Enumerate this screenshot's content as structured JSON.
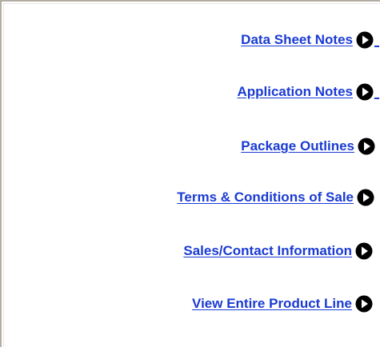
{
  "links": [
    {
      "label": "Data Sheet Notes",
      "icon": "arrow-right-circle-icon"
    },
    {
      "label": "Application Notes",
      "icon": "arrow-right-circle-icon"
    },
    {
      "label": "Package Outlines",
      "icon": "arrow-right-circle-icon"
    },
    {
      "label": "Terms & Conditions of Sale",
      "icon": "arrow-right-circle-icon"
    },
    {
      "label": "Sales/Contact Information",
      "icon": "arrow-right-circle-icon"
    },
    {
      "label": "View Entire Product Line",
      "icon": "arrow-right-circle-icon"
    }
  ],
  "colors": {
    "link": "#1a3bd3",
    "visited_stub": "#7b2fa0",
    "icon_fill": "#000000",
    "border": "#b3ada3"
  }
}
